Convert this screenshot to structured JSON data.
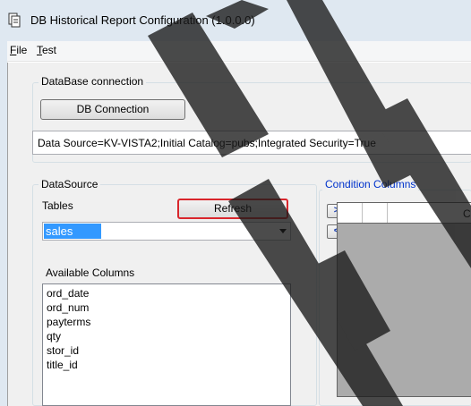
{
  "window": {
    "title": "DB Historical Report Configuration (1.0.0.0)"
  },
  "menu": [
    {
      "label": "File",
      "accel": "F",
      "rest": "ile"
    },
    {
      "label": "Test",
      "accel": "T",
      "rest": "est"
    }
  ],
  "db_group": {
    "legend": "DataBase connection",
    "button_label": "DB Connection",
    "connection_string": "Data Source=KV-VISTA2;Initial Catalog=pubs;Integrated Security=True"
  },
  "datasource_group": {
    "legend": "DataSource",
    "tables_label": "Tables",
    "refresh_label": "Refresh",
    "selected_table": "sales",
    "available_columns_label": "Available Columns",
    "columns": [
      "ord_date",
      "ord_num",
      "payterms",
      "qty",
      "stor_id",
      "title_id"
    ]
  },
  "condition": {
    "legend": "Condition Columns",
    "add_label": ">",
    "remove_label": "<",
    "grid_header": "Co"
  },
  "colors": {
    "highlight": "#3399ff",
    "legend_blue": "#0033cc",
    "focus_red": "#d9262c"
  }
}
